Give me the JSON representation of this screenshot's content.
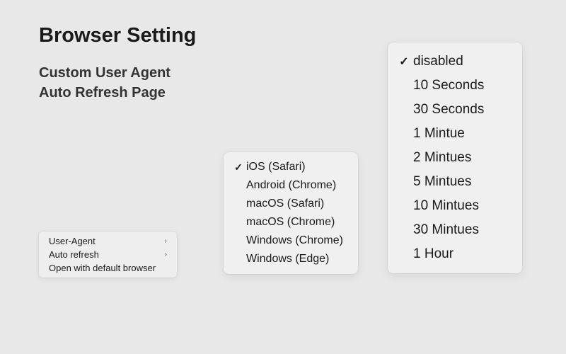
{
  "title": "Browser Setting",
  "subtitle_custom_ua": "Custom User Agent",
  "subtitle_auto_refresh": "Auto Refresh Page",
  "context_menu": {
    "items": [
      {
        "label": "User-Agent",
        "has_submenu": true
      },
      {
        "label": "Auto refresh",
        "has_submenu": true
      },
      {
        "label": "Open with default browser",
        "has_submenu": false
      }
    ]
  },
  "ua_menu": {
    "selected_index": 0,
    "items": [
      "iOS (Safari)",
      "Android (Chrome)",
      "macOS (Safari)",
      "macOS (Chrome)",
      "Windows (Chrome)",
      "Windows (Edge)"
    ]
  },
  "refresh_menu": {
    "selected_index": 0,
    "items": [
      "disabled",
      "10 Seconds",
      "30 Seconds",
      "1 Mintue",
      "2 Mintues",
      "5 Mintues",
      "10 Mintues",
      "30 Mintues",
      "1 Hour"
    ]
  },
  "checkmark_glyph": "✓",
  "chevron_glyph": "›"
}
